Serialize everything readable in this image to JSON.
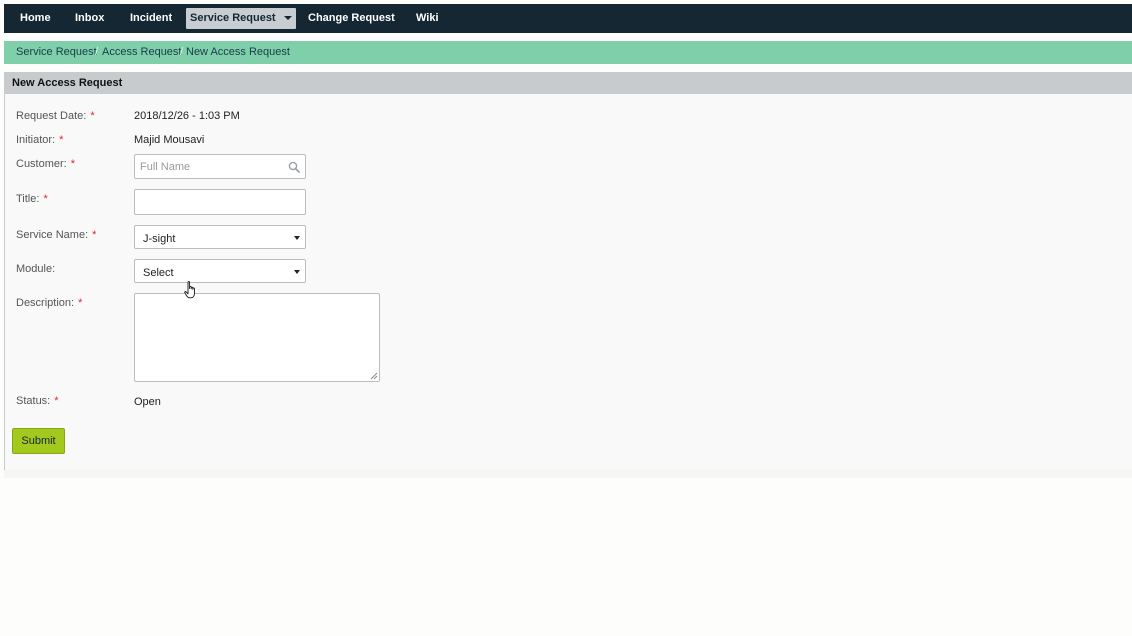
{
  "nav": {
    "items": [
      {
        "label": "Home"
      },
      {
        "label": "Inbox"
      },
      {
        "label": "Incident"
      },
      {
        "label": "Service Request",
        "active": true
      },
      {
        "label": "Change Request"
      },
      {
        "label": "Wiki"
      }
    ]
  },
  "breadcrumb": {
    "items": [
      "Service Request",
      "Access Request",
      "New Access Request"
    ],
    "separator": "/"
  },
  "panel": {
    "title": "New Access Request"
  },
  "form": {
    "required_marker": "*",
    "request_date": {
      "label": "Request Date:",
      "value": "2018/12/26 - 1:03 PM"
    },
    "initiator": {
      "label": "Initiator:",
      "value": "Majid Mousavi"
    },
    "customer": {
      "label": "Customer:",
      "placeholder": "Full Name",
      "value": "",
      "icon": "search-icon"
    },
    "title": {
      "label": "Title:",
      "value": ""
    },
    "service_name": {
      "label": "Service Name:",
      "selected": "J-sight"
    },
    "module": {
      "label": "Module:",
      "selected": "Select"
    },
    "description": {
      "label": "Description:",
      "value": ""
    },
    "status": {
      "label": "Status:",
      "value": "Open"
    },
    "submit_label": "Submit"
  },
  "colors": {
    "navbar": "#142733",
    "breadcrumb_bg": "#7fd0aa",
    "panel_heading": "#c8cbce",
    "submit_button": "#a3c81e",
    "required": "#dd2233"
  }
}
